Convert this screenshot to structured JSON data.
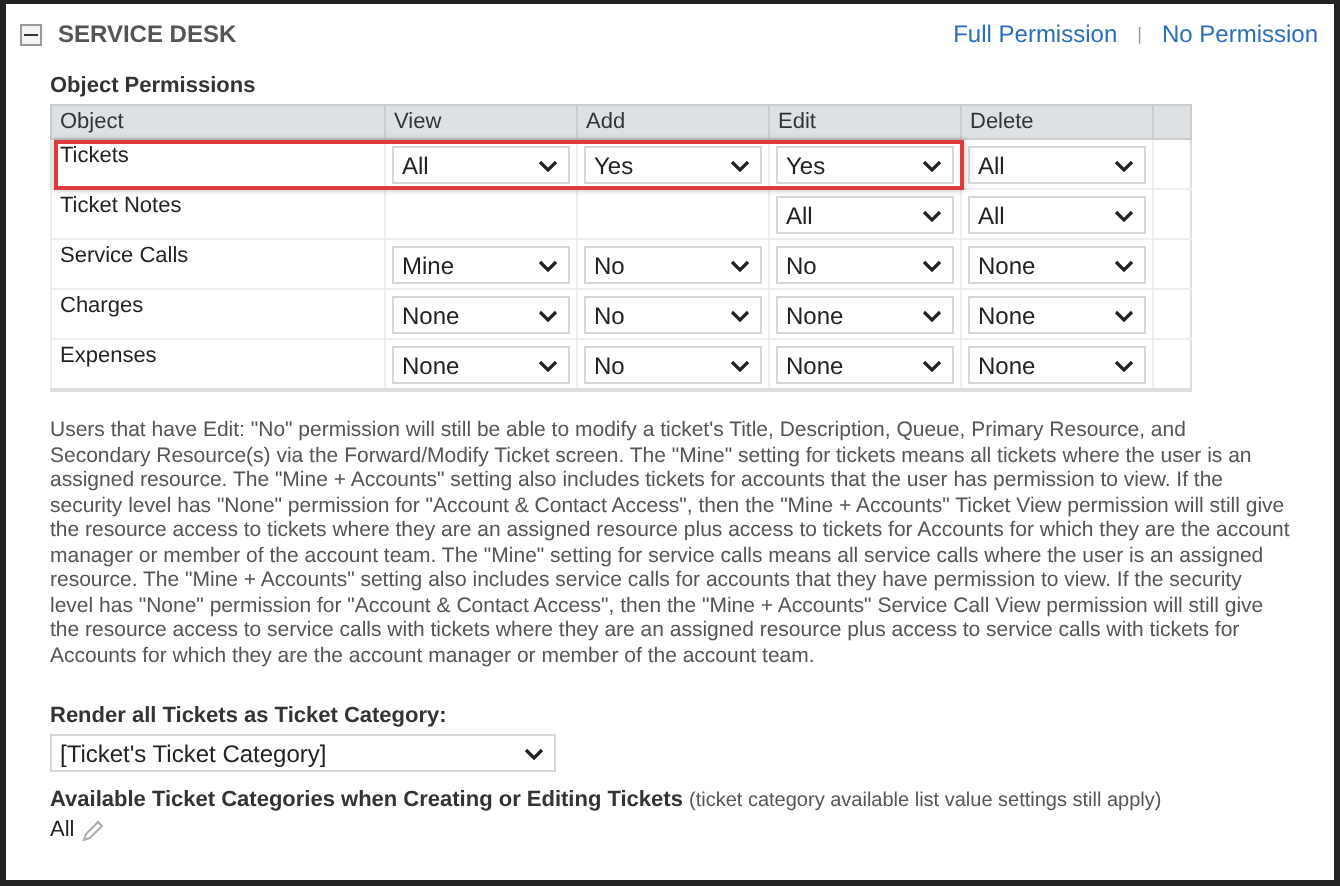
{
  "section": {
    "title": "SERVICE DESK",
    "expanded": true,
    "links": [
      "Full Permission",
      "No Permission"
    ],
    "separator": "|"
  },
  "permissions": {
    "title": "Object Permissions",
    "columns": [
      "Object",
      "View",
      "Add",
      "Edit",
      "Delete"
    ],
    "rows": [
      {
        "highlighted": true,
        "cells": [
          {
            "kind": "text",
            "value": "Tickets"
          },
          {
            "kind": "select",
            "value": "All"
          },
          {
            "kind": "select",
            "value": "Yes"
          },
          {
            "kind": "select",
            "value": "Yes"
          },
          {
            "kind": "select",
            "value": "All"
          }
        ]
      },
      {
        "highlighted": false,
        "cells": [
          {
            "kind": "text",
            "value": "Ticket Notes"
          },
          {
            "kind": "blank"
          },
          {
            "kind": "blank"
          },
          {
            "kind": "select",
            "value": "All"
          },
          {
            "kind": "select",
            "value": "All"
          }
        ]
      },
      {
        "highlighted": false,
        "cells": [
          {
            "kind": "text",
            "value": "Service Calls"
          },
          {
            "kind": "select",
            "value": "Mine"
          },
          {
            "kind": "select",
            "value": "No"
          },
          {
            "kind": "select",
            "value": "No"
          },
          {
            "kind": "select",
            "value": "None"
          }
        ]
      },
      {
        "highlighted": false,
        "cells": [
          {
            "kind": "text",
            "value": "Charges"
          },
          {
            "kind": "select",
            "value": "None"
          },
          {
            "kind": "select",
            "value": "No"
          },
          {
            "kind": "select",
            "value": "None"
          },
          {
            "kind": "select",
            "value": "None"
          }
        ]
      },
      {
        "highlighted": false,
        "cells": [
          {
            "kind": "text",
            "value": "Expenses"
          },
          {
            "kind": "select",
            "value": "None"
          },
          {
            "kind": "select",
            "value": "No"
          },
          {
            "kind": "select",
            "value": "None"
          },
          {
            "kind": "select",
            "value": "None"
          }
        ]
      }
    ]
  },
  "note": "Users that have Edit: \"No\" permission will still be able to modify a ticket's Title, Description, Queue, Primary Resource, and Secondary Resource(s) via the Forward/Modify Ticket screen. The \"Mine\" setting for tickets means all tickets where the user is an assigned resource. The \"Mine + Accounts\" setting also includes tickets for accounts that the user has permission to view. If the security level has \"None\" permission for \"Account & Contact Access\", then the \"Mine + Accounts\" Ticket View permission will still give the resource access to tickets where they are an assigned resource plus access to tickets for Accounts for which they are the account manager or member of the account team. The \"Mine\" setting for service calls means all service calls where the user is an assigned resource. The \"Mine + Accounts\" setting also includes service calls for accounts that they have permission to view. If the security level has \"None\" permission for \"Account & Contact Access\", then the \"Mine + Accounts\" Service Call View permission will still give the resource access to service calls with tickets where they are an assigned resource plus access to service calls with tickets for Accounts for which they are the account manager or member of the account team.",
  "render_category": {
    "label": "Render all Tickets as Ticket Category:",
    "value": "[Ticket's Ticket Category]"
  },
  "available_categories": {
    "label": "Available Ticket Categories when Creating or Editing Tickets",
    "hint": "(ticket category available list value settings still apply)",
    "value": "All"
  }
}
